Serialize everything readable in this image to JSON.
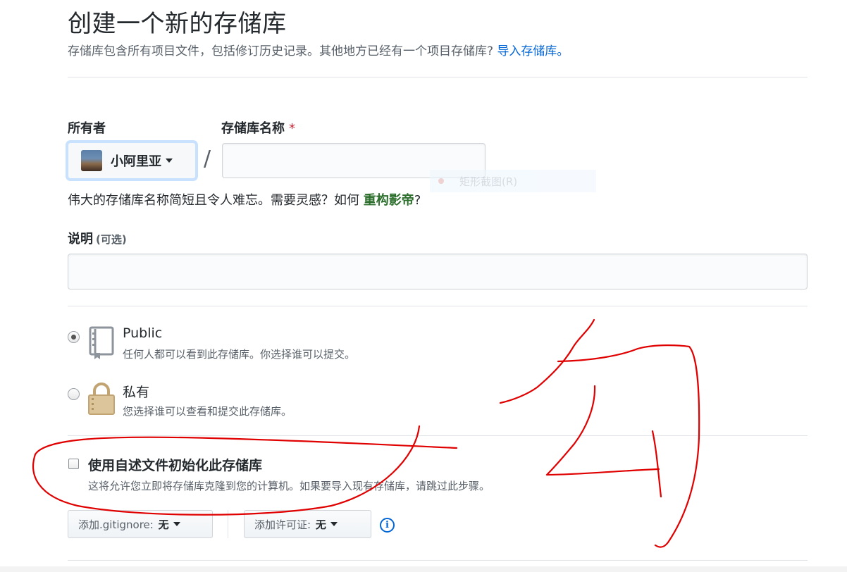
{
  "header": {
    "title": "创建一个新的存储库",
    "subtitle": "存储库包含所有项目文件，包括修订历史记录。其他地方已经有一个项目存储库?",
    "import_link": "导入存储库。"
  },
  "owner": {
    "label": "所有者",
    "value": "小阿里亚"
  },
  "repo_name": {
    "label": "存储库名称",
    "required_mark": "*",
    "separator": "/",
    "value": ""
  },
  "ghost_tooltip": "矩形截图(R)",
  "name_hint": {
    "prefix": "伟大的存储库名称简短且令人难忘。需要灵感？如何",
    "suggestion": "重构影帝",
    "suffix": "?"
  },
  "description": {
    "label": "说明",
    "optional": "(可选)",
    "value": ""
  },
  "visibility": {
    "selected": "public",
    "options": [
      {
        "id": "public",
        "title": "Public",
        "desc": "任何人都可以看到此存储库。你选择谁可以提交。"
      },
      {
        "id": "private",
        "title": "私有",
        "desc": "您选择谁可以查看和提交此存储库。"
      }
    ]
  },
  "init_readme": {
    "checked": false,
    "label": "使用自述文件初始化此存储库",
    "desc": "这将允许您立即将存储库克隆到您的计算机。如果要导入现有存储库，请跳过此步骤。"
  },
  "gitignore": {
    "label": "添加.gitignore:",
    "value": "无"
  },
  "license": {
    "label": "添加许可证:",
    "value": "无"
  },
  "icons": {
    "public": "repo-book-icon",
    "private": "lock-icon",
    "info": "info-icon",
    "info_glyph": "i"
  },
  "colors": {
    "link": "#0366d6",
    "suggestion": "#2c6e2c",
    "required": "#cb2431",
    "annotation": "#e00000"
  }
}
